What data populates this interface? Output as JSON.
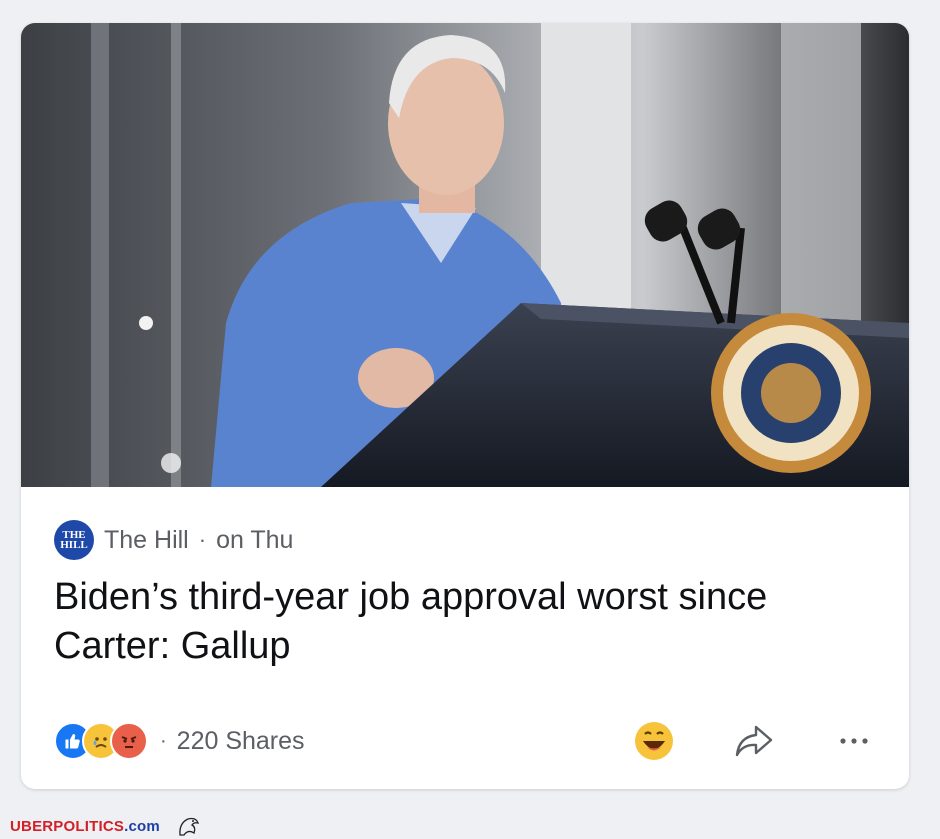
{
  "post": {
    "source_name": "The Hill",
    "source_logo_text": "THE HILL",
    "separator": "·",
    "timestamp": "on Thu",
    "headline": "Biden’s third-year job approval worst since Carter: Gallup",
    "reaction_icons": [
      "like-icon",
      "sad-face-icon",
      "angry-face-icon"
    ],
    "shares_separator": "·",
    "shares": "220 Shares",
    "actions": [
      "react-icon",
      "share-icon",
      "more-icon"
    ],
    "image_subject": "president-speaking-at-podium"
  },
  "watermark": {
    "part1": "UBERPOLITICS",
    "part2": ".com",
    "colors": {
      "primary": "#1f3ea3",
      "accent": "#d32027"
    }
  },
  "colors": {
    "brand": "#1877f2",
    "text": "#101114",
    "muted": "#5b5e63",
    "background": "#eef0f3"
  }
}
